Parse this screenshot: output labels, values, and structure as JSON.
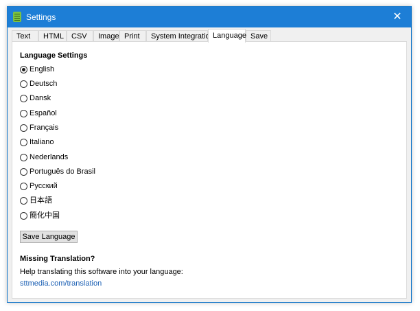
{
  "window": {
    "title": "Settings",
    "accent_color": "#1d7ed6"
  },
  "tabs": [
    {
      "label": "Text"
    },
    {
      "label": "HTML"
    },
    {
      "label": "CSV"
    },
    {
      "label": "Image"
    },
    {
      "label": "Print"
    },
    {
      "label": "System Integration"
    },
    {
      "label": "Language",
      "active": true
    },
    {
      "label": "Save"
    }
  ],
  "language": {
    "heading": "Language Settings",
    "selected": "English",
    "options": [
      "English",
      "Deutsch",
      "Dansk",
      "Español",
      "Français",
      "Italiano",
      "Nederlands",
      "Português do Brasil",
      "Русский",
      "日本語",
      "簡化中国"
    ],
    "save_label": "Save Language"
  },
  "missing": {
    "heading": "Missing Translation?",
    "text": "Help translating this software into your language:",
    "link": "sttmedia.com/translation"
  }
}
